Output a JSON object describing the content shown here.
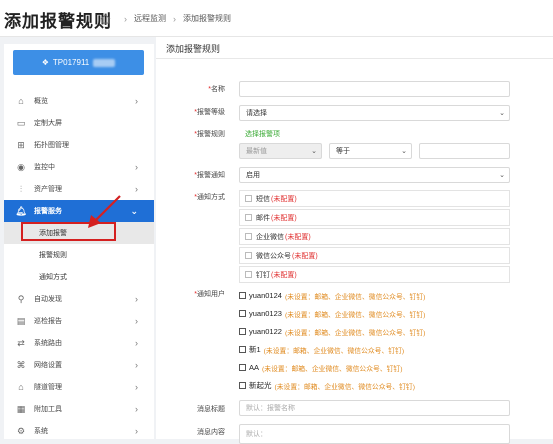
{
  "header": {
    "title": "添加报警规则",
    "breadcrumb": [
      "远程监测",
      "添加报警规则"
    ]
  },
  "sidebar": {
    "device": "TP017911",
    "items": [
      {
        "label": "概览",
        "icon": "home-icon",
        "chevron": "›"
      },
      {
        "label": "定制大屏",
        "icon": "monitor-icon",
        "chevron": ""
      },
      {
        "label": "拓扑图管理",
        "icon": "topology-icon",
        "chevron": ""
      },
      {
        "label": "监控中",
        "icon": "eye-icon",
        "chevron": "›"
      },
      {
        "label": "资产管理",
        "icon": "sliders-icon",
        "chevron": "›"
      },
      {
        "label": "报警服务",
        "icon": "bell-icon",
        "chevron": "⌄"
      }
    ],
    "submenu": [
      "添加报警",
      "报警规则",
      "通知方式"
    ],
    "items2": [
      {
        "label": "自动发现",
        "icon": "search-icon",
        "chevron": "›"
      },
      {
        "label": "巡检报告",
        "icon": "report-icon",
        "chevron": "›"
      },
      {
        "label": "系统路由",
        "icon": "route-icon",
        "chevron": "›"
      },
      {
        "label": "网络设置",
        "icon": "network-icon",
        "chevron": "›"
      },
      {
        "label": "隧道管理",
        "icon": "tunnel-icon",
        "chevron": "›"
      },
      {
        "label": "附加工具",
        "icon": "tools-icon",
        "chevron": "›"
      },
      {
        "label": "系统",
        "icon": "gear-icon",
        "chevron": "›"
      }
    ]
  },
  "form": {
    "section_title": "添加报警规则",
    "name_label": "名称",
    "level_label": "报警等级",
    "level_value": "请选择",
    "rule_label": "报警规则",
    "rule_link": "选择报警项",
    "cond_metric": "最新值",
    "cond_op": "等于",
    "notify_label": "报警通知",
    "notify_value": "启用",
    "method_label": "通知方式",
    "methods": [
      {
        "name": "短信",
        "status": "(未配置)"
      },
      {
        "name": "邮件",
        "status": "(未配置)"
      },
      {
        "name": "企业微信",
        "status": "(未配置)"
      },
      {
        "name": "微信公众号",
        "status": "(未配置)"
      },
      {
        "name": "钉钉",
        "status": "(未配置)"
      }
    ],
    "user_label": "通知用户",
    "users": [
      {
        "name": "yuan0124",
        "note": "(未设置：邮箱、企业微信、微信公众号、钉钉)"
      },
      {
        "name": "yuan0123",
        "note": "(未设置：邮箱、企业微信、微信公众号、钉钉)"
      },
      {
        "name": "yuan0122",
        "note": "(未设置：邮箱、企业微信、微信公众号、钉钉)"
      },
      {
        "name": "新1",
        "note": "(未设置：邮箱、企业微信、微信公众号、钉钉)"
      },
      {
        "name": "AA",
        "note": "(未设置：邮箱、企业微信、微信公众号、钉钉)"
      },
      {
        "name": "新起光",
        "note": "(未设置：邮箱、企业微信、微信公众号、钉钉)"
      }
    ],
    "msg_title_label": "消息标题",
    "msg_title_placeholder": "默认：报警名称",
    "msg_body_label": "消息内容",
    "msg_body_placeholder": "默认："
  },
  "colors": {
    "accent": "#1f6fd6",
    "device_btn": "#3d8fe6",
    "highlight": "#d42020",
    "warn": "#e03030",
    "note": "#e08a1e",
    "link": "#3aaa35"
  }
}
